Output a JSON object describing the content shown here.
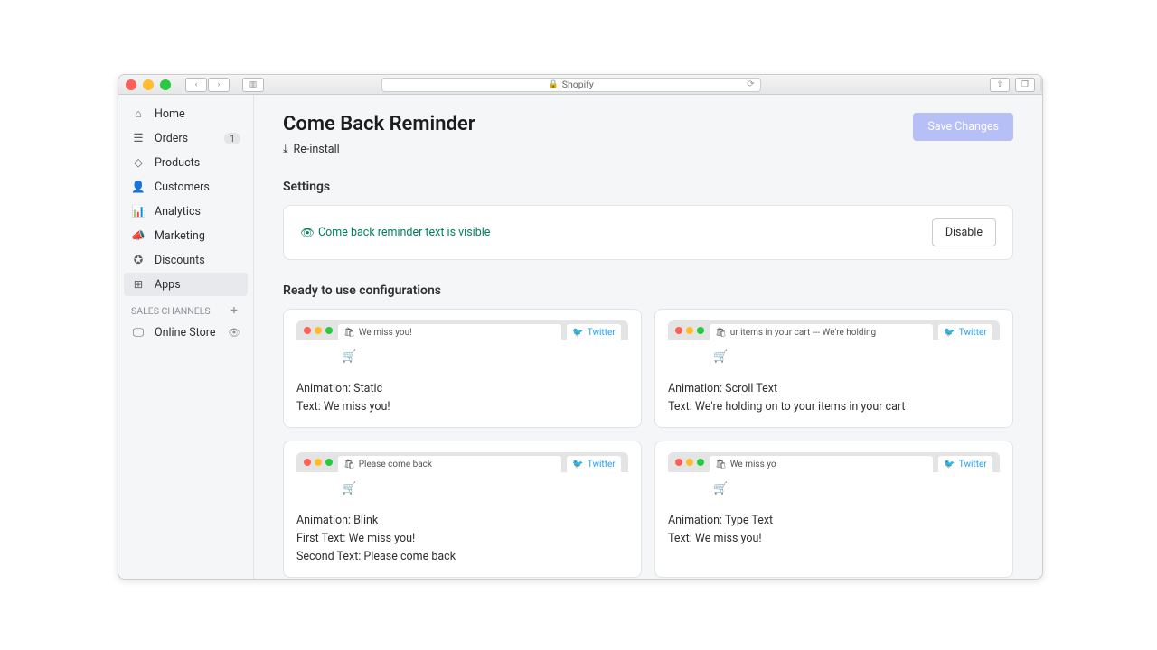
{
  "browser": {
    "url_text": "Shopify"
  },
  "sidebar": {
    "items": [
      {
        "label": "Home"
      },
      {
        "label": "Orders",
        "badge": "1"
      },
      {
        "label": "Products"
      },
      {
        "label": "Customers"
      },
      {
        "label": "Analytics"
      },
      {
        "label": "Marketing"
      },
      {
        "label": "Discounts"
      },
      {
        "label": "Apps"
      }
    ],
    "channels_header": "SALES CHANNELS",
    "channel": {
      "label": "Online Store"
    }
  },
  "page": {
    "title": "Come Back Reminder",
    "reinstall": "Re-install",
    "save": "Save Changes",
    "settings_header": "Settings",
    "status_text": "Come back reminder text is visible",
    "disable": "Disable",
    "configs_header": "Ready to use configurations",
    "twitter": "Twitter",
    "configs": [
      {
        "preview": "We miss you!",
        "line1": "Animation: Static",
        "line2": "Text: We miss you!",
        "line3": ""
      },
      {
        "preview": "ur items in your cart --- We're holding",
        "line1": "Animation: Scroll Text",
        "line2": "Text: We're holding on to your items in your cart",
        "line3": ""
      },
      {
        "preview": "Please come back",
        "line1": "Animation: Blink",
        "line2": "First Text: We miss you!",
        "line3": "Second Text: Please come back"
      },
      {
        "preview": "We miss yo",
        "line1": "Animation: Type Text",
        "line2": "Text: We miss you!",
        "line3": ""
      }
    ]
  }
}
